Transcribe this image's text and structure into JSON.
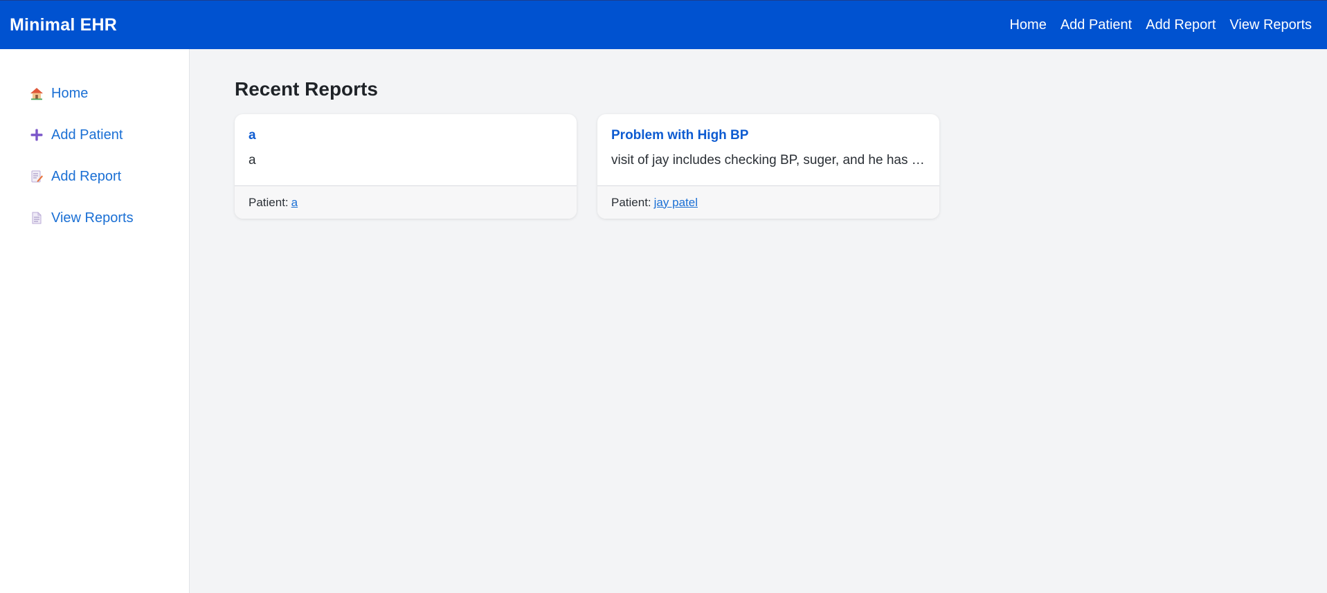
{
  "header": {
    "brand": "Minimal EHR",
    "nav": [
      "Home",
      "Add Patient",
      "Add Report",
      "View Reports"
    ]
  },
  "sidebar": {
    "items": [
      {
        "icon": "house-icon",
        "label": "Home"
      },
      {
        "icon": "plus-icon",
        "label": "Add Patient"
      },
      {
        "icon": "memo-icon",
        "label": "Add Report"
      },
      {
        "icon": "document-icon",
        "label": "View Reports"
      }
    ]
  },
  "main": {
    "title": "Recent Reports",
    "reports": [
      {
        "title": "a",
        "text": "a",
        "patient_label": "Patient:",
        "patient": "a"
      },
      {
        "title": "Problem with High BP",
        "text": "visit of jay includes checking BP, suger, and he has high BP",
        "patient_label": "Patient:",
        "patient": "jay patel"
      }
    ]
  },
  "colors": {
    "header_bg": "#0052d0",
    "link": "#1a6fd4",
    "card_title": "#0d5bd1",
    "page_bg": "#f3f4f6"
  }
}
